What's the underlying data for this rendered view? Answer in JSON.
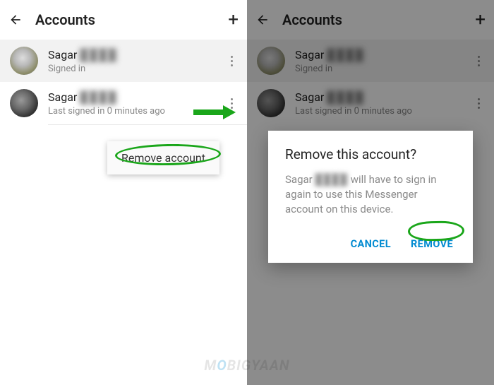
{
  "left": {
    "header": {
      "title": "Accounts"
    },
    "accounts": [
      {
        "name": "Sagar",
        "surname_redacted": "████",
        "status": "Signed in"
      },
      {
        "name": "Sagar",
        "surname_redacted": "████",
        "status": "Last signed in 0 minutes ago"
      }
    ],
    "menu": {
      "remove_label": "Remove account"
    }
  },
  "right": {
    "header": {
      "title": "Accounts"
    },
    "accounts": [
      {
        "name": "Sagar",
        "surname_redacted": "████",
        "status": "Signed in"
      },
      {
        "name": "Sagar",
        "surname_redacted": "████",
        "status": "Last signed in 0 minutes ago"
      }
    ],
    "dialog": {
      "title": "Remove this account?",
      "body_prefix": "Sagar ",
      "body_redacted": "████",
      "body_suffix": " will have to sign in again to use this Messenger account on this device.",
      "cancel": "CANCEL",
      "remove": "REMOVE"
    }
  },
  "annotations": {
    "arrow_color": "#1aa61a",
    "circle_color": "#1aa61a"
  },
  "watermark": "MOBIGYAAN"
}
